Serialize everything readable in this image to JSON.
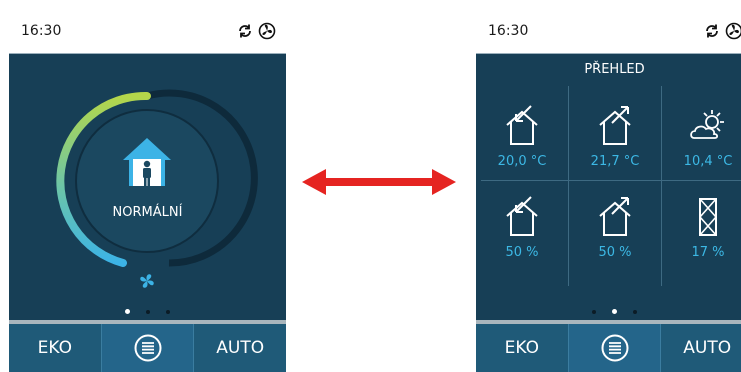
{
  "left_screen": {
    "time": "16:30",
    "mode_label": "NORMÁLNÍ",
    "buttons": {
      "eko": "EKO",
      "auto": "AUTO"
    },
    "pager_active": 0,
    "icons": [
      "sync-icon",
      "fan-icon",
      "home-person-icon",
      "fan-small-icon",
      "menu-icon"
    ]
  },
  "right_screen": {
    "time": "16:30",
    "title": "PŘEHLED",
    "cells": [
      {
        "icon": "house-arrow-in-icon",
        "value": "20,0 °C"
      },
      {
        "icon": "house-arrow-out-icon",
        "value": "21,7 °C"
      },
      {
        "icon": "sun-cloud-icon",
        "value": "10,4 °C"
      },
      {
        "icon": "house-arrow-in-icon",
        "value": "50 %"
      },
      {
        "icon": "house-arrow-out-icon",
        "value": "50 %"
      },
      {
        "icon": "filter-icon",
        "value": "17 %"
      }
    ],
    "buttons": {
      "eko": "EKO",
      "auto": "AUTO"
    },
    "pager_active": 1
  },
  "connector": {
    "icon": "double-arrow-icon",
    "color": "#e52421"
  },
  "colors": {
    "screen_bg": "#173f56",
    "button_bg": "#1f5a78",
    "value_blue": "#3cb8e5"
  }
}
